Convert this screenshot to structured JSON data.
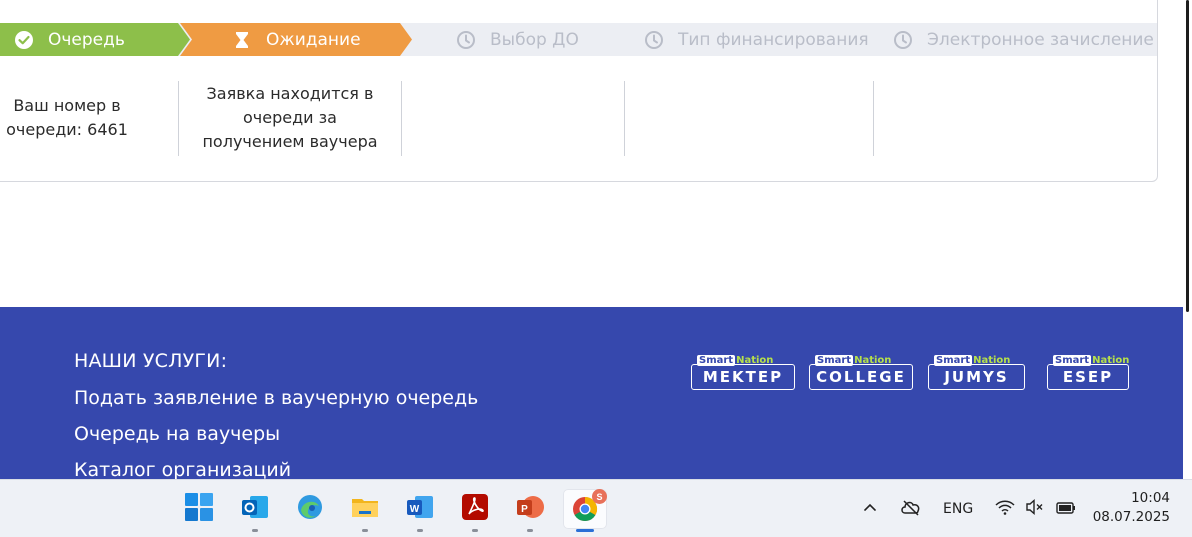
{
  "stepper": {
    "steps": [
      {
        "label": "Очередь",
        "state": "done",
        "icon": "check-circle-icon"
      },
      {
        "label": "Ожидание",
        "state": "active",
        "icon": "hourglass-icon"
      },
      {
        "label": "Выбор ДО",
        "state": "pending",
        "icon": "clock-icon"
      },
      {
        "label": "Тип финансирования",
        "state": "pending",
        "icon": "clock-icon"
      },
      {
        "label": "Электронное зачисление",
        "state": "pending",
        "icon": "clock-icon"
      }
    ],
    "colors": {
      "done": "#8dbf4a",
      "active": "#ef9b43",
      "pending": "#b9bdc8"
    }
  },
  "details": {
    "queue_number_text": "Ваш номер в очереди: 6461",
    "status_text": "Заявка находится в очереди за получением ваучера"
  },
  "footer": {
    "heading": "НАШИ УСЛУГИ:",
    "links": [
      "Подать заявление в ваучерную очередь",
      "Очередь на ваучеры",
      "Каталог организаций"
    ],
    "brands": [
      {
        "tag_smart": "Smart",
        "tag_nation": "Nation",
        "name": "MEKTEP"
      },
      {
        "tag_smart": "Smart",
        "tag_nation": "Nation",
        "name": "COLLEGE"
      },
      {
        "tag_smart": "Smart",
        "tag_nation": "Nation",
        "name": "JUMYS"
      },
      {
        "tag_smart": "Smart",
        "tag_nation": "Nation",
        "name": "ESEP"
      }
    ],
    "background": "#3648ad"
  },
  "taskbar": {
    "apps": [
      "start-icon",
      "outlook-icon",
      "edge-copilot-icon",
      "file-explorer-icon",
      "word-icon",
      "acrobat-icon",
      "powerpoint-icon",
      "chrome-icon"
    ],
    "chrome_badge": "S",
    "tray": {
      "language": "ENG",
      "time": "10:04",
      "date": "08.07.2025"
    }
  }
}
